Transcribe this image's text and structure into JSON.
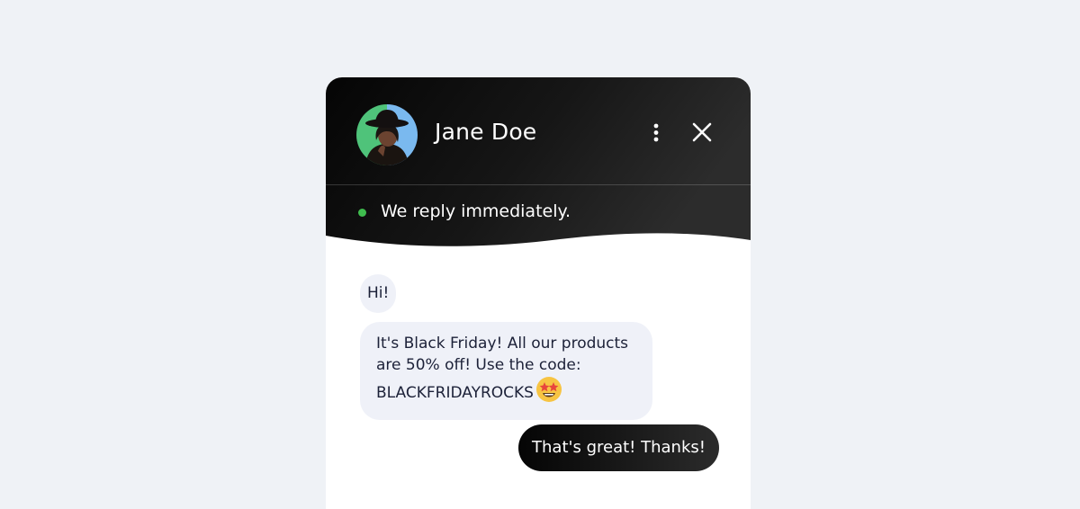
{
  "header": {
    "agent_name": "Jane Doe",
    "status_text": "We reply immediately.",
    "status_color": "#3fbc4e",
    "menu_icon": "more-vertical-icon",
    "close_icon": "close-icon"
  },
  "messages": [
    {
      "sender": "agent",
      "text": "Hi!"
    },
    {
      "sender": "agent",
      "text": "It's Black Friday! All our products are 50% off! Use the code: BLACKFRIDAYROCKS",
      "emoji": "star-struck-emoji"
    },
    {
      "sender": "user",
      "text": "That's great! Thanks!"
    }
  ],
  "colors": {
    "page_background": "#eff2f6",
    "header_background": "#111111",
    "agent_bubble": "#eff1f8",
    "user_bubble": "#111111",
    "status_online": "#3fbc4e"
  }
}
